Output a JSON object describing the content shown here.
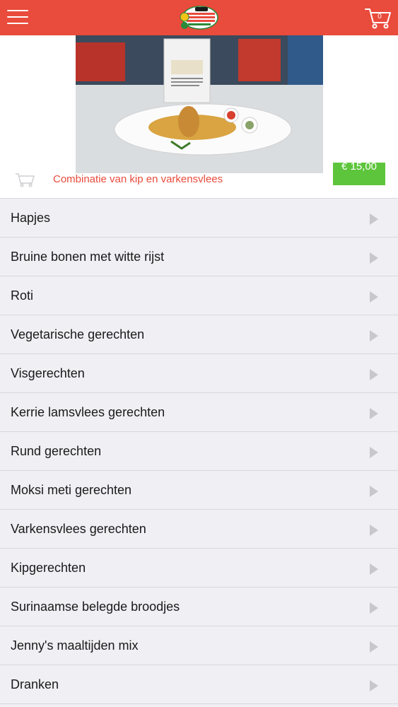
{
  "header": {
    "logo": "Jenny's logo",
    "cart_count": "0",
    "colors": {
      "bar": "#e94b3c"
    }
  },
  "featured": {
    "description": "Combinatie van kip en varkensvlees",
    "price": "€ 15,00",
    "colors": {
      "description": "#e94b3c",
      "price_bg": "#5dc53b"
    }
  },
  "categories": [
    "Hapjes",
    "Bruine bonen met witte rijst",
    "Roti",
    "Vegetarische gerechten",
    "Visgerechten",
    "Kerrie lamsvlees gerechten",
    "Rund gerechten",
    "Moksi meti gerechten",
    "Varkensvlees gerechten",
    "Kipgerechten",
    "Surinaamse belegde broodjes",
    "Jenny's maaltijden mix",
    "Dranken"
  ]
}
